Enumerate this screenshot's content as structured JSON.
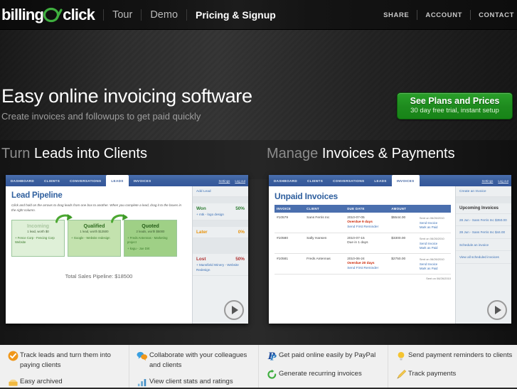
{
  "header": {
    "logo": {
      "part1": "billing",
      "part2": "On",
      "part3": "click"
    },
    "nav": [
      {
        "label": "Tour",
        "active": false
      },
      {
        "label": "Demo",
        "active": false
      },
      {
        "label": "Pricing & Signup",
        "active": true
      }
    ],
    "utility": [
      {
        "label": "SHARE"
      },
      {
        "label": "ACCOUNT"
      },
      {
        "label": "CONTACT"
      }
    ]
  },
  "hero": {
    "title": "Easy online invoicing software",
    "subtitle": "Create invoices and followups to get paid quickly",
    "cta": {
      "line1": "See Plans and Prices",
      "line2": "30 day free trial, instant setup",
      "color": "#1e8b1e"
    }
  },
  "sections": {
    "left": {
      "muted": "Turn",
      "rest": "Leads into Clients"
    },
    "right": {
      "muted": "Manage",
      "rest": "Invoices & Payments"
    }
  },
  "leads_shot": {
    "tabs": [
      {
        "label": "DASHBOARD",
        "active": false
      },
      {
        "label": "CLIENTS",
        "active": false
      },
      {
        "label": "CONVERSATIONS",
        "active": false
      },
      {
        "label": "LEADS",
        "active": true
      },
      {
        "label": "INVOICES",
        "active": false
      }
    ],
    "tabs_right": [
      "Settings",
      "Log out"
    ],
    "panel_title": "Lead Pipeline",
    "panel_note": "Click and hold on the arrows to drag leads from one box to another. When you complete a lead, drag it to the boxes in the right column.",
    "stages": [
      {
        "name": "Incoming",
        "summary": "1 lead, worth $0",
        "items": [
          "+ Fence Corp - Fencing Corp Website"
        ]
      },
      {
        "name": "Qualified",
        "summary": "1 lead, worth $13500",
        "items": [
          "+ Google - Website redesign"
        ]
      },
      {
        "name": "Quoted",
        "summary": "2 leads, worth $5000",
        "items": [
          "+ Freds Antennas - Marketing project",
          "+ kvgu - Joe Dirt"
        ]
      }
    ],
    "total": "Total Sales Pipeline: $18500",
    "sidebar": {
      "add_lead": "Add Lead",
      "groups": [
        {
          "title": "Won",
          "pct": "50%",
          "color": "#2e7d32",
          "items": [
            "+ mtk - logo design"
          ]
        },
        {
          "title": "Later",
          "pct": "0%",
          "color": "#e8920a",
          "items": []
        },
        {
          "title": "Lost",
          "pct": "50%",
          "color": "#b03030",
          "items": [
            "+ Mansfield Winery - Website Redesign"
          ]
        }
      ]
    }
  },
  "invoices_shot": {
    "tabs": [
      {
        "label": "DASHBOARD",
        "active": false
      },
      {
        "label": "CLIENTS",
        "active": false
      },
      {
        "label": "CONVERSATIONS",
        "active": false
      },
      {
        "label": "LEADS",
        "active": false
      },
      {
        "label": "INVOICES",
        "active": true
      }
    ],
    "tabs_right": [
      "Settings",
      "Log out"
    ],
    "panel_title": "Unpaid Invoices",
    "columns": [
      "INVOICE",
      "CLIENT",
      "DUE DATE",
      "AMOUNT",
      ""
    ],
    "rows": [
      {
        "invoice": "#10579",
        "client": "Sans Ferris Inc",
        "date": "2010-07-05",
        "status": "Overdue 9 days",
        "status_kind": "overdue",
        "reminder": "Send First Reminder",
        "amount": "$5544.00",
        "sent": "Sent on 06/26/2010",
        "actions": [
          "Send Invoice",
          "Mark as Paid"
        ]
      },
      {
        "invoice": "#10580",
        "client": "Sally Hansen",
        "date": "2010-07-15",
        "status": "Due in 1 days",
        "status_kind": "due",
        "reminder": "",
        "amount": "$3300.00",
        "sent": "Sent on 06/26/2010",
        "actions": [
          "Send Invoice",
          "Mark as Paid"
        ]
      },
      {
        "invoice": "#10581",
        "client": "Freds Antennas",
        "date": "2010-06-24",
        "status": "Overdue 20 days",
        "status_kind": "overdue",
        "reminder": "Send First Reminder",
        "amount": "$2750.00",
        "sent": "Sent on 06/26/2010",
        "actions": [
          "Send Invoice",
          "Mark as Paid"
        ]
      }
    ],
    "footer_note": "Sent on 06/26/2010",
    "sidebar": {
      "create": "Create an Invoice",
      "upcoming_title": "Upcoming Invoices",
      "upcoming": [
        "28 Jun - Sans Ferris Inc $350.00",
        "28 Jun - Sans Ferris Inc $44.00"
      ],
      "links": [
        "Schedule an invoice",
        "View all scheduled invoices"
      ]
    }
  },
  "features": [
    {
      "items": [
        {
          "icon": "check-circle-icon",
          "text": "Track leads and turn them into paying clients"
        },
        {
          "icon": "archive-icon",
          "text": "Easy archived"
        }
      ]
    },
    {
      "items": [
        {
          "icon": "speech-bubbles-icon",
          "text": "Collaborate with your colleagues and clients"
        },
        {
          "icon": "bar-chart-icon",
          "text": "View client stats and ratings"
        }
      ]
    },
    {
      "items": [
        {
          "icon": "paypal-icon",
          "text": "Get paid online easily by PayPal"
        },
        {
          "icon": "recurring-icon",
          "text": "Generate recurring invoices"
        }
      ]
    },
    {
      "items": [
        {
          "icon": "lightbulb-icon",
          "text": "Send payment reminders to clients"
        },
        {
          "icon": "pencil-icon",
          "text": "Track payments"
        }
      ]
    }
  ]
}
